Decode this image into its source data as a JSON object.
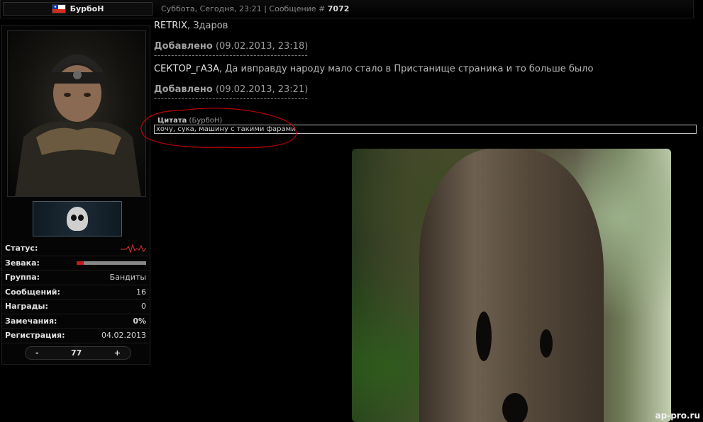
{
  "header": {
    "username": "БурбоН",
    "post_date": "Суббота, Сегодня, 23:21",
    "post_label": "Сообщение #",
    "post_number": "7072"
  },
  "profile": {
    "stats": [
      {
        "label": "Статус:",
        "value": ""
      },
      {
        "label": "Зевака:",
        "value": "",
        "bar_fraction": 0.1
      },
      {
        "label": "Группа:",
        "value": "Бандиты"
      },
      {
        "label": "Сообщений:",
        "value": "16"
      },
      {
        "label": "Награды:",
        "value": "0"
      },
      {
        "label": "Замечания:",
        "value": "0%"
      },
      {
        "label": "Регистрация:",
        "value": "04.02.2013"
      }
    ],
    "reputation": {
      "minus": "-",
      "value": "77",
      "plus": "+"
    }
  },
  "post": {
    "l1_nick": "RETRIX",
    "l1_msg": ", Здаров",
    "added1_label": "Добавлено",
    "added1_time": " (09.02.2013, 23:18)",
    "separator": "---------------------------------------------",
    "l2_nick": "СЕКТОР_гАЗА",
    "l2_msg": ", Да ивправду народу мало стало в Пристанище страника и то больше было",
    "added2_label": "Добавлено",
    "added2_time": " (09.02.2013, 23:21)",
    "quote_label": "Цитата",
    "quote_author": " (БурбоН)",
    "quote_text": "хочу, сука, машину с такими фарами"
  },
  "watermark": "ap-pro.ru",
  "colors": {
    "accent_red": "#c41a1a",
    "annotation": "#c00000"
  }
}
